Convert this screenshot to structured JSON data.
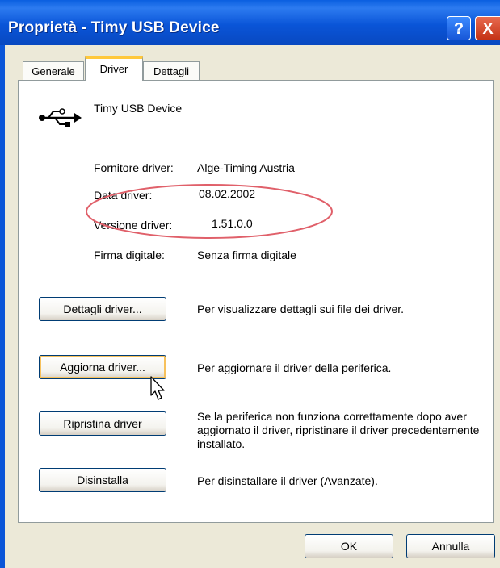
{
  "window": {
    "title": "Proprietà - Timy USB Device",
    "help_label": "?",
    "close_label": "X",
    "title_color": "#0A55D8"
  },
  "tabs": [
    {
      "label": "Generale",
      "selected": false
    },
    {
      "label": "Driver",
      "selected": true
    },
    {
      "label": "Dettagli",
      "selected": false
    }
  ],
  "device": {
    "icon": "usb-icon",
    "name": "Timy USB Device"
  },
  "properties": [
    {
      "label": "Fornitore driver:",
      "value": "Alge-Timing Austria"
    },
    {
      "label": "Data driver:",
      "value": "08.02.2002"
    },
    {
      "label": "Versione driver:",
      "value": "1.51.0.0"
    },
    {
      "label": "Firma digitale:",
      "value": "Senza firma digitale"
    }
  ],
  "annotation": {
    "shape": "ellipse",
    "color": "#E0606A"
  },
  "actions": [
    {
      "button": "Dettagli driver...",
      "description": "Per visualizzare dettagli sui file dei driver."
    },
    {
      "button": "Aggiorna driver...",
      "description": "Per aggiornare il driver della periferica."
    },
    {
      "button": "Ripristina driver",
      "description": "Se la periferica non funziona correttamente dopo aver aggiornato il driver, ripristinare il driver precedentemente installato."
    },
    {
      "button": "Disinstalla",
      "description": "Per disinstallare il driver (Avanzate)."
    }
  ],
  "footer": {
    "ok_label": "OK",
    "cancel_label": "Annulla"
  }
}
